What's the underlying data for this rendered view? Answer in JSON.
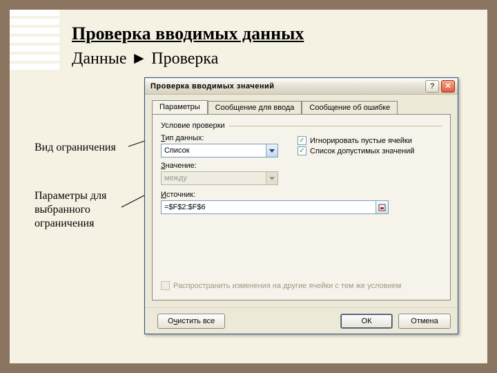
{
  "heading": "Проверка вводимых данных",
  "subheading": "Данные ► Проверка",
  "annotation1": "Вид ограничения",
  "annotation2_l1": "Параметры для",
  "annotation2_l2": "выбранного",
  "annotation2_l3": "ограничения",
  "dialog": {
    "title": "Проверка вводимых значений",
    "tabs": {
      "parameters": "Параметры",
      "input_msg": "Сообщение для ввода",
      "error_msg": "Сообщение об ошибке"
    },
    "group_label": "Условие проверки",
    "field_type_label": "Тип данных:",
    "field_type_value": "Список",
    "field_value_label": "Значение:",
    "field_value_value": "между",
    "field_source_label": "Источник:",
    "field_source_value": "=$F$2:$F$6",
    "chk_ignore": "Игнорировать пустые ячейки",
    "chk_dropdown": "Список допустимых значений",
    "chk_propagate": "Распространить изменения на другие ячейки с тем же условием",
    "btn_clear": "Очистить все",
    "btn_ok": "ОК",
    "btn_cancel": "Отмена"
  }
}
